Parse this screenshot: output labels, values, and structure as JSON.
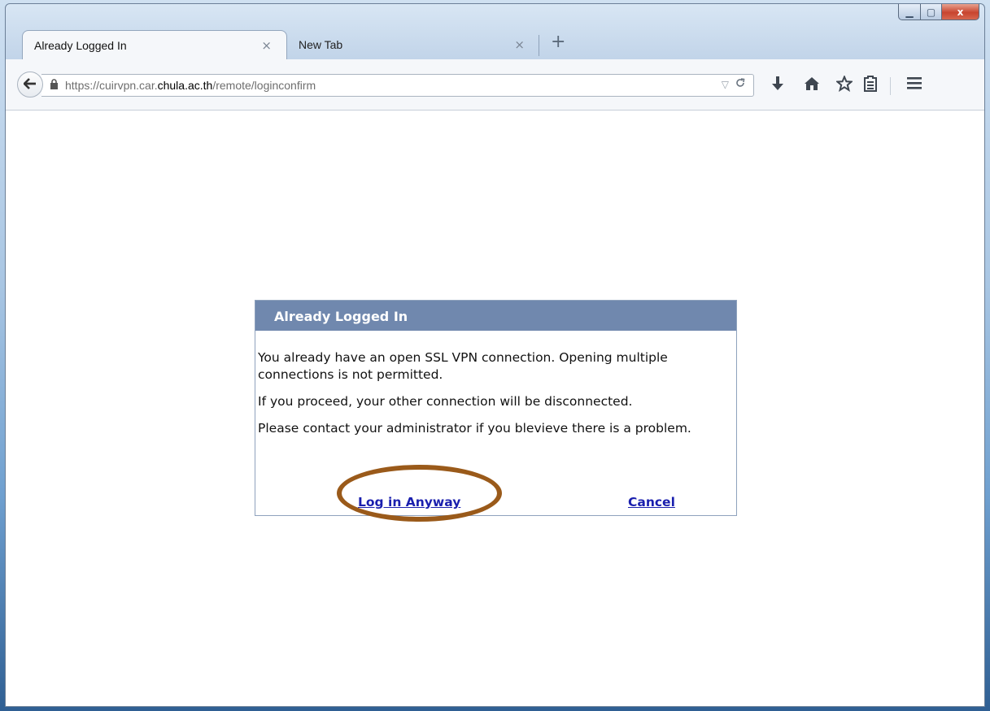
{
  "browser": {
    "tabs": [
      {
        "label": "Already Logged In",
        "close": "×",
        "active": true
      },
      {
        "label": "New Tab",
        "close": "×",
        "active": false
      }
    ],
    "new_tab": "+",
    "url": {
      "prefix": "https://cuirvpn.car.",
      "host": "chula.ac.th",
      "path": "/remote/loginconfirm"
    },
    "icons": {
      "back": "back-arrow-icon",
      "lock": "lock-icon",
      "dropdown": "dropdown-icon",
      "reload": "reload-icon",
      "download": "download-icon",
      "home": "home-icon",
      "bookmark": "star-icon",
      "reading_list": "reading-list-icon",
      "menu": "hamburger-menu-icon"
    },
    "window_controls": {
      "minimize": "▁",
      "maximize": "▢",
      "close": "x"
    }
  },
  "dialog": {
    "title": "Already Logged In",
    "paragraphs": [
      "You already have an open SSL VPN connection. Opening multiple connections is not permitted.",
      "If you proceed, your other connection will be disconnected.",
      "Please contact your administrator if you blevieve there is a problem."
    ],
    "login_anyway": "Log in Anyway",
    "cancel": "Cancel"
  },
  "annotation": {
    "color": "#9a5a1a"
  }
}
